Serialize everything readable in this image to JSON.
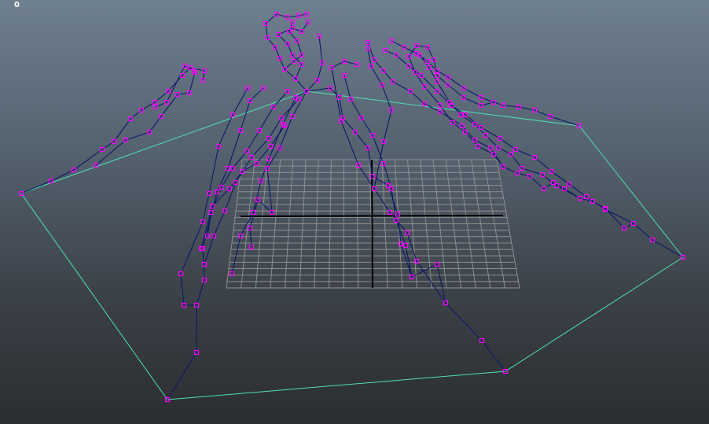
{
  "viewport": {
    "frame_counter": "0",
    "background_top": "#6e7f8f",
    "background_bottom": "#2b2d30"
  },
  "colors": {
    "grid": "#8f8f8f",
    "grid_axis": "#000000",
    "bone": "#0b1a66",
    "joint": "#ff00ff",
    "boundary": "#4fe0b0"
  }
}
